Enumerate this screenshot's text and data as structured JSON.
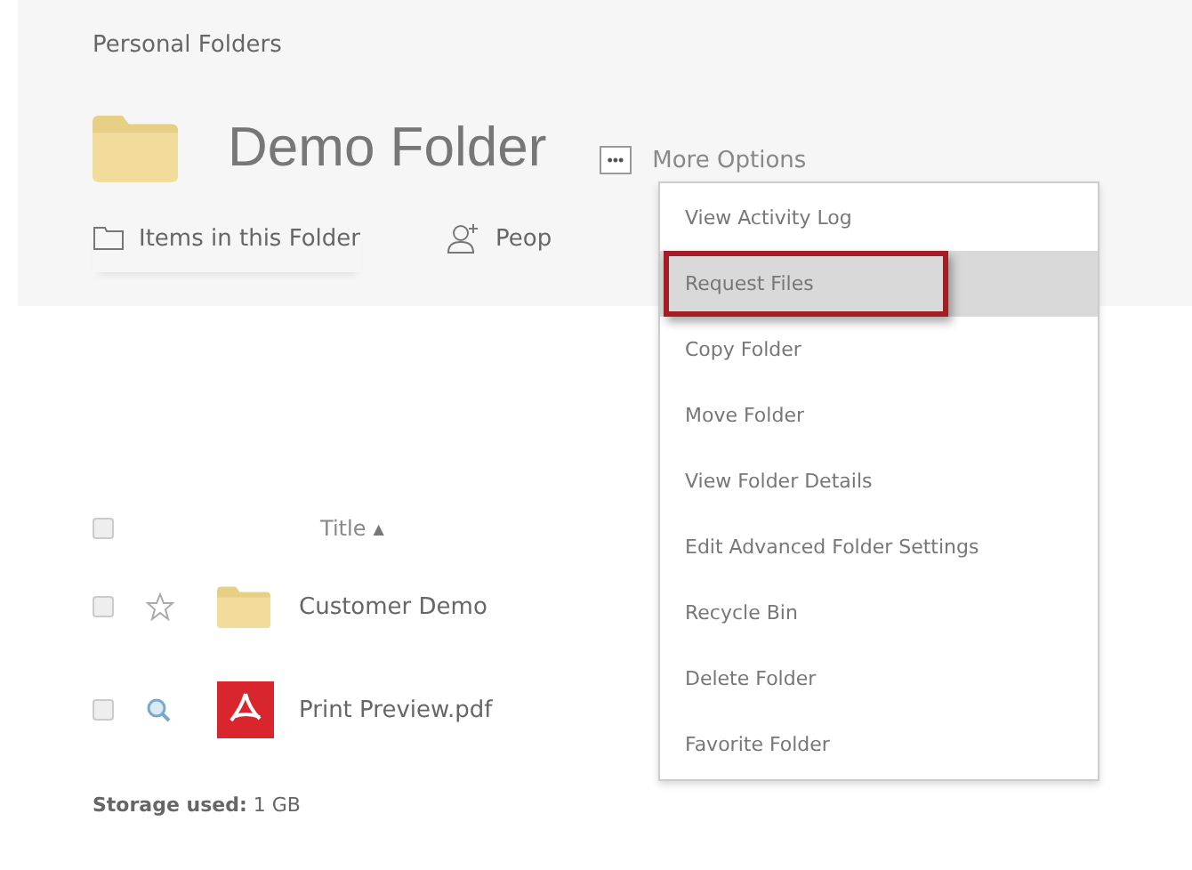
{
  "breadcrumb": "Personal Folders",
  "title": "Demo Folder",
  "more_button": {
    "label": "•••",
    "text": "More Options"
  },
  "tabs": [
    {
      "label": "Items in this Folder",
      "kind": "folder",
      "selected": true
    },
    {
      "label": "Peop",
      "kind": "people",
      "selected": false
    }
  ],
  "menu": [
    {
      "label": "View Activity Log",
      "selected": false
    },
    {
      "label": "Request Files",
      "selected": true
    },
    {
      "label": "Copy Folder",
      "selected": false
    },
    {
      "label": "Move Folder",
      "selected": false
    },
    {
      "label": "View Folder Details",
      "selected": false
    },
    {
      "label": "Edit Advanced Folder Settings",
      "selected": false
    },
    {
      "label": "Recycle Bin",
      "selected": false
    },
    {
      "label": "Delete Folder",
      "selected": false
    },
    {
      "label": "Favorite Folder",
      "selected": false
    }
  ],
  "table": {
    "header": {
      "checked": false,
      "title": "Title",
      "sort": "▲"
    },
    "rows": [
      {
        "kind": "folder",
        "name": "Customer Demo",
        "checked": false
      },
      {
        "kind": "pdf",
        "name": "Print Preview.pdf",
        "checked": false
      }
    ]
  },
  "storage": {
    "label": "Storage used:",
    "value": "1 GB"
  }
}
